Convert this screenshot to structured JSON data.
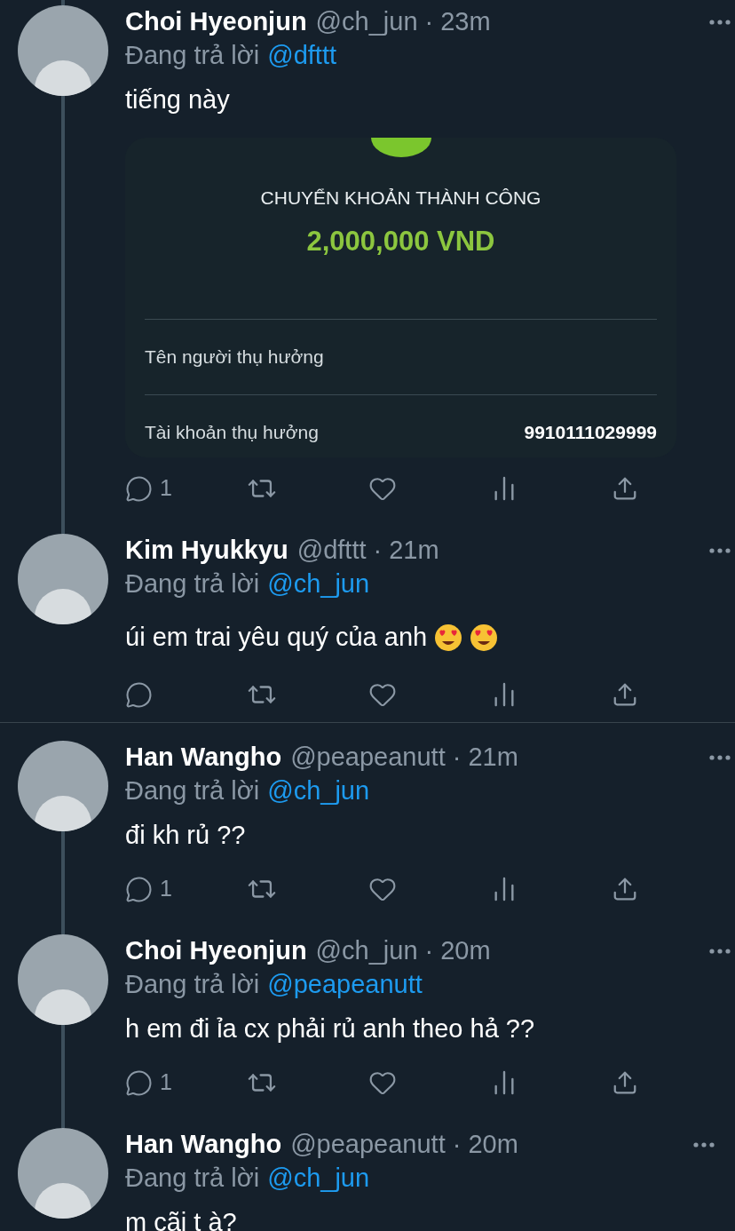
{
  "tweets": [
    {
      "name": "Choi Hyeonjun",
      "handle": "@ch_jun",
      "time": "· 23m",
      "reply_label": "Đang trả lời",
      "reply_to": "@dfttt",
      "text": "tiếng này",
      "thread_above": true,
      "thread_below": true,
      "divider_below": false,
      "attachment": {
        "kind": "transfer_receipt",
        "title": "CHUYỂN KHOẢN THÀNH CÔNG",
        "amount": "2,000,000 VND",
        "rows": [
          {
            "label": "Tên người thụ hưởng"
          },
          {
            "label": "Tài khoản thụ hưởng",
            "value": "9910111029999"
          }
        ]
      },
      "actions": [
        {
          "kind": "reply",
          "count": "1"
        },
        {
          "kind": "retweet"
        },
        {
          "kind": "like"
        },
        {
          "kind": "views"
        },
        {
          "kind": "share"
        }
      ]
    },
    {
      "name": "Kim Hyukkyu",
      "handle": "@dfttt",
      "time": "· 21m",
      "reply_label": "Đang trả lời",
      "reply_to": "@ch_jun",
      "text": "úi em trai yêu quý của anh",
      "emojis": [
        {
          "kind": "heart_eyes"
        },
        {
          "kind": "heart_eyes"
        }
      ],
      "thread_above": true,
      "thread_below": false,
      "divider_below": true,
      "actions": [
        {
          "kind": "reply"
        },
        {
          "kind": "retweet"
        },
        {
          "kind": "like"
        },
        {
          "kind": "views"
        },
        {
          "kind": "share"
        }
      ]
    },
    {
      "name": "Han Wangho",
      "handle": "@peapeanutt",
      "time": "· 21m",
      "reply_label": "Đang trả lời",
      "reply_to": "@ch_jun",
      "text": "đi kh rủ ??",
      "thread_above": false,
      "thread_below": true,
      "divider_below": false,
      "actions": [
        {
          "kind": "reply",
          "count": "1"
        },
        {
          "kind": "retweet"
        },
        {
          "kind": "like"
        },
        {
          "kind": "views"
        },
        {
          "kind": "share"
        }
      ]
    },
    {
      "name": "Choi Hyeonjun",
      "handle": "@ch_jun",
      "time": "· 20m",
      "reply_label": "Đang trả lời",
      "reply_to": "@peapeanutt",
      "text": "h em đi ỉa cx phải rủ anh theo hả ??",
      "thread_above": true,
      "thread_below": true,
      "divider_below": false,
      "actions": [
        {
          "kind": "reply",
          "count": "1"
        },
        {
          "kind": "retweet"
        },
        {
          "kind": "like"
        },
        {
          "kind": "views"
        },
        {
          "kind": "share"
        }
      ]
    },
    {
      "name": "Han Wangho",
      "handle": "@peapeanutt",
      "time": "· 20m",
      "reply_label": "Đang trả lời",
      "reply_to": "@ch_jun",
      "text": "m cãi t à?",
      "thread_above": true,
      "thread_below": false,
      "divider_below": false
    }
  ]
}
